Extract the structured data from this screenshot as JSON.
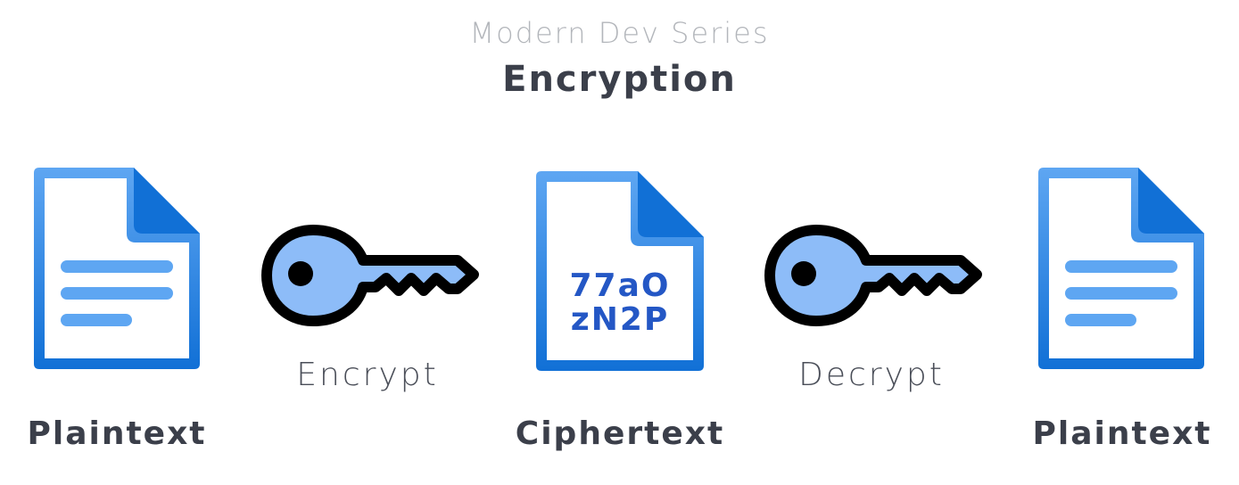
{
  "header": {
    "series": "Modern Dev Series",
    "title": "Encryption"
  },
  "steps": {
    "plaintext_left": "Plaintext",
    "encrypt": "Encrypt",
    "ciphertext": "Ciphertext",
    "cipher_line1": "77aO",
    "cipher_line2": "zN2P",
    "decrypt": "Decrypt",
    "plaintext_right": "Plaintext"
  },
  "colors": {
    "doc_blue_light": "#5ea6f2",
    "doc_blue_dark": "#1170d6",
    "key_fill": "#8dbcf8",
    "key_outline": "#000000",
    "text_dark": "#3b3f4a",
    "text_muted": "#b3b6bb",
    "cipher_text": "#2457c5"
  },
  "icons": [
    "document-icon",
    "key-icon",
    "cipher-document-icon",
    "key-icon",
    "document-icon"
  ]
}
